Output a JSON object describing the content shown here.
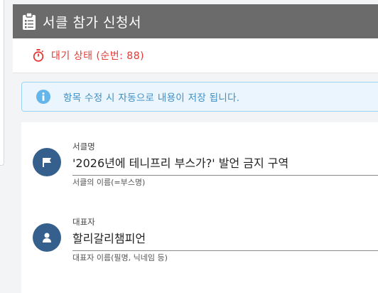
{
  "header": {
    "title": "서클 참가 신청서",
    "icon": "clipboard-icon"
  },
  "status": {
    "text": "대기 상태 (순번: 88)",
    "icon": "stopwatch-icon",
    "color": "#e53935"
  },
  "info": {
    "text": "항목 수정 시 자동으로 내용이 저장 됩니다.",
    "icon": "info-icon"
  },
  "fields": {
    "circle_name": {
      "label": "서클명",
      "value": "'2026년에 테니프리 부스가?' 발언 금지 구역",
      "hint": "서클의 이름(=부스명)",
      "icon": "flag-icon"
    },
    "representative": {
      "label": "대표자",
      "value": "할리갈리챔피언",
      "hint": "대표자 이름(필명, 닉네임 등)",
      "icon": "person-icon"
    }
  }
}
